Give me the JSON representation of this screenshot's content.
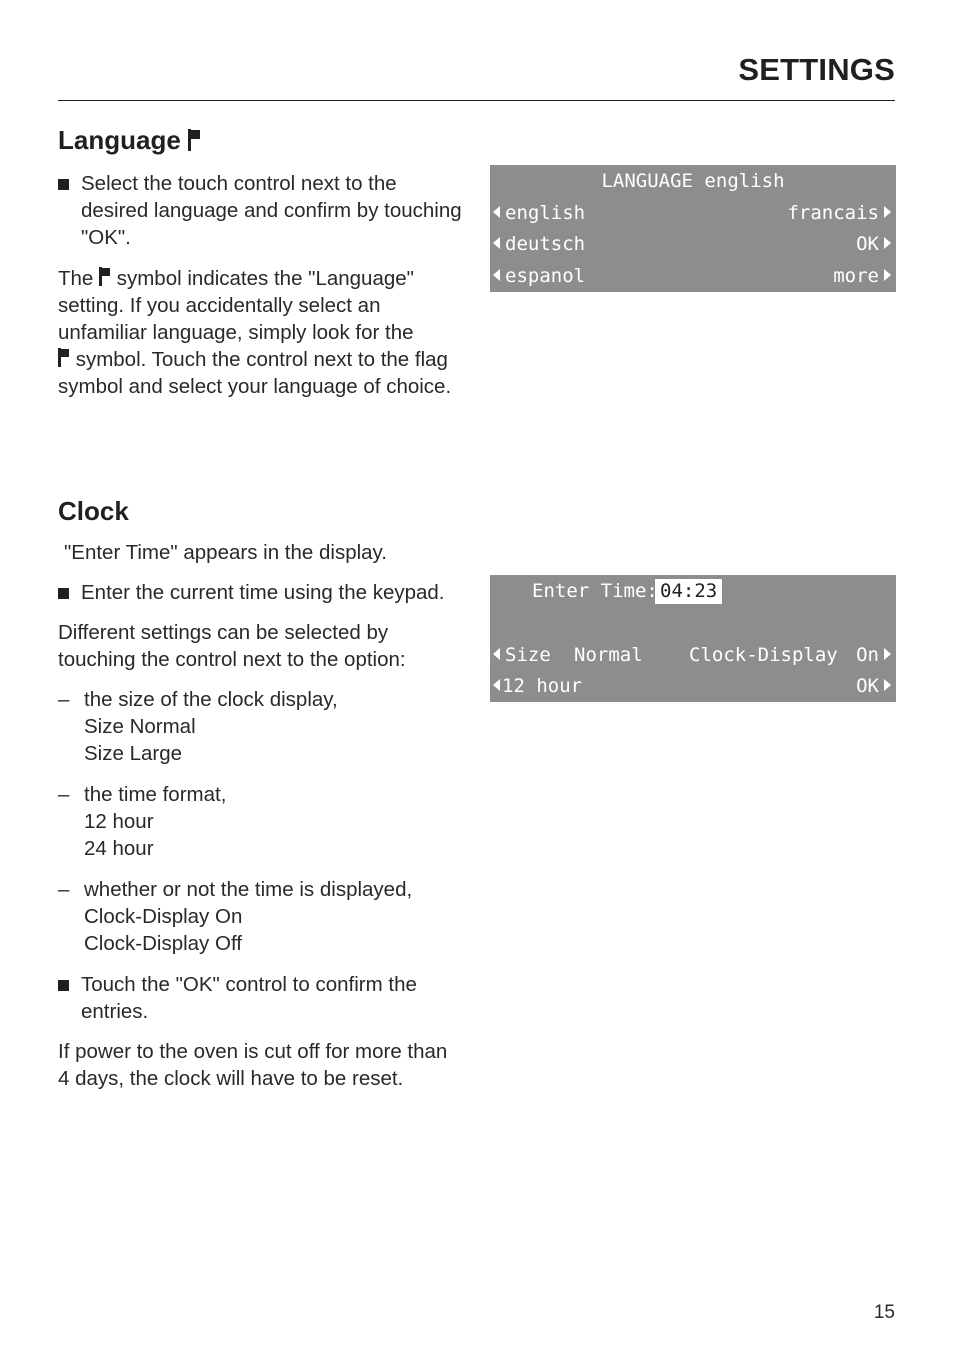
{
  "header": {
    "title": "SETTINGS"
  },
  "language": {
    "heading": "Language",
    "heading_icon": "flag-icon",
    "step": "Select the touch control next to the desired language and confirm by touching \"OK\".",
    "para_part1": "The",
    "para_part2": "symbol indicates the \"Language\" setting. If you accidentally select an unfamiliar language, simply look for the",
    "para_part3": "symbol. Touch the control next to the flag symbol and select your language of choice.",
    "display": {
      "title": "LANGUAGE english",
      "rows": [
        {
          "left": "english",
          "right": "francais"
        },
        {
          "left": "deutsch",
          "right": "OK"
        },
        {
          "left": "espanol",
          "right": "more"
        }
      ]
    }
  },
  "clock": {
    "heading": "Clock",
    "intro": "\"Enter Time\" appears in the display.",
    "step1": "Enter the current time using the keypad.",
    "options_intro": "Different settings can be selected by touching the control next to the option:",
    "options": [
      {
        "label": "the size of the clock display,",
        "values": [
          "Size Normal",
          "Size Large"
        ]
      },
      {
        "label": "the time format,",
        "values": [
          "12 hour",
          "24 hour"
        ]
      },
      {
        "label": "whether or not the time is displayed,",
        "values": [
          "Clock-Display On",
          "Clock-Display Off"
        ]
      }
    ],
    "step2": "Touch the \"OK\" control to confirm the entries.",
    "note": "If power to the oven is cut off for more than 4 days, the clock will have to be reset.",
    "display": {
      "time_label": "Enter Time:",
      "time_value": "04:23",
      "row1": {
        "left": "Size",
        "left_value": "Normal",
        "right_label": "Clock-Display",
        "right": "On"
      },
      "row2": {
        "left": "12 hour",
        "right": "OK"
      }
    }
  },
  "footer": {
    "page_number": "15"
  }
}
